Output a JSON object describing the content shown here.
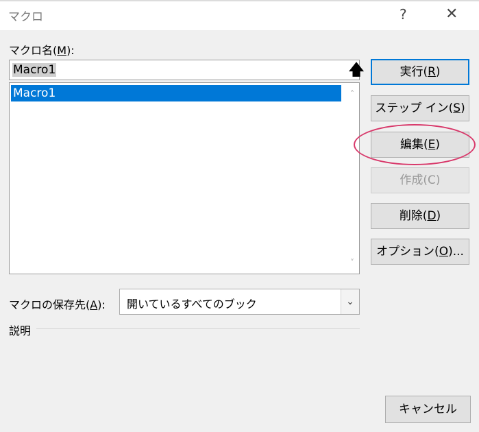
{
  "window": {
    "title": "マクロ",
    "help_glyph": "?",
    "close_glyph": "✕"
  },
  "macro_name": {
    "label_prefix": "マクロ名(",
    "label_key": "M",
    "label_suffix": "):",
    "value": "Macro1",
    "upload_glyph": "🡅"
  },
  "macro_list": {
    "items": [
      "Macro1"
    ],
    "selected_index": 0,
    "scroll_up_glyph": "˄",
    "scroll_down_glyph": "˅"
  },
  "buttons": {
    "run": {
      "prefix": "実行(",
      "key": "R",
      "suffix": ")"
    },
    "step_in": {
      "prefix": "ステップ イン(",
      "key": "S",
      "suffix": ")"
    },
    "edit": {
      "prefix": "編集(",
      "key": "E",
      "suffix": ")"
    },
    "create": {
      "label": "作成(C)",
      "disabled": true
    },
    "delete": {
      "prefix": "削除(",
      "key": "D",
      "suffix": ")"
    },
    "options": {
      "prefix": "オプション(",
      "key": "O",
      "suffix": ")..."
    },
    "cancel": {
      "label": "キャンセル"
    }
  },
  "store_in": {
    "label_prefix": "マクロの保存先(",
    "label_key": "A",
    "label_suffix": "):",
    "selected": "開いているすべてのブック",
    "arrow_glyph": "⌄"
  },
  "description": {
    "label": "説明"
  },
  "colors": {
    "selection": "#0078d7",
    "highlight_ring": "#d8386a",
    "dialog_bg": "#f0f0f0"
  }
}
